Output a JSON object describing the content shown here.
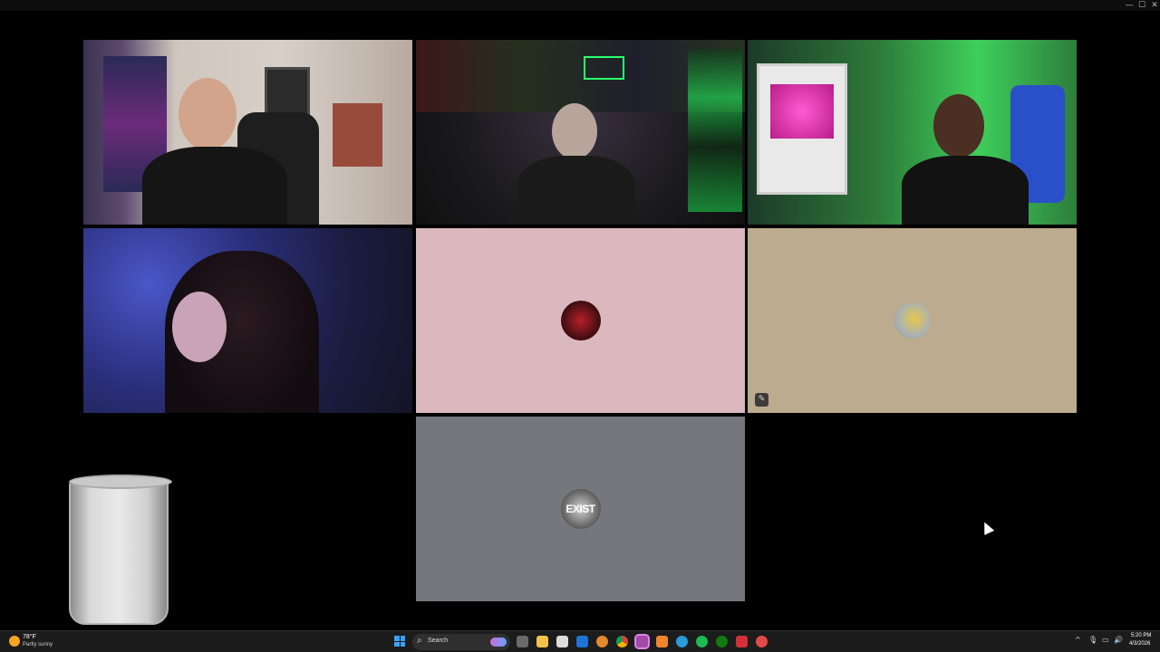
{
  "window": {
    "controls": {
      "minimize": "—",
      "maximize": "☐",
      "close": "✕"
    }
  },
  "tiles": [
    {
      "id": "tile-1",
      "type": "video",
      "speaking": false
    },
    {
      "id": "tile-2",
      "type": "video",
      "speaking": false
    },
    {
      "id": "tile-3",
      "type": "video",
      "speaking": true
    },
    {
      "id": "tile-4",
      "type": "video",
      "speaking": false
    },
    {
      "id": "tile-5",
      "type": "avatar",
      "bg": "#dbb8bd",
      "avatar_text": ""
    },
    {
      "id": "tile-6",
      "type": "avatar",
      "bg": "#bcab8e",
      "badge_icon": "paperclip-icon"
    },
    {
      "id": "tile-7",
      "type": "avatar",
      "bg": "#76777d",
      "avatar_text": "EXIST"
    }
  ],
  "taskbar": {
    "weather": {
      "temp": "78°F",
      "condition": "Partly sunny",
      "icon": "sun-icon"
    },
    "search_placeholder": "Search",
    "apps": [
      "task-view-icon",
      "file-explorer-icon",
      "notes-icon",
      "outlook-icon",
      "chrome-icon",
      "app-orange-icon",
      "streaming-app-icon",
      "app-amber-icon",
      "edge-icon",
      "spotify-icon",
      "xbox-icon",
      "app-red-icon",
      "app-target-icon"
    ],
    "tray": {
      "chevron": "^",
      "mic": "🎙",
      "network": "▭",
      "volume": "🔊"
    },
    "clock": {
      "time": "5:20 PM",
      "date": "4/3/2026"
    }
  },
  "colors": {
    "speaking_outline": "#27c93f",
    "taskbar": "#1c1c1c"
  }
}
